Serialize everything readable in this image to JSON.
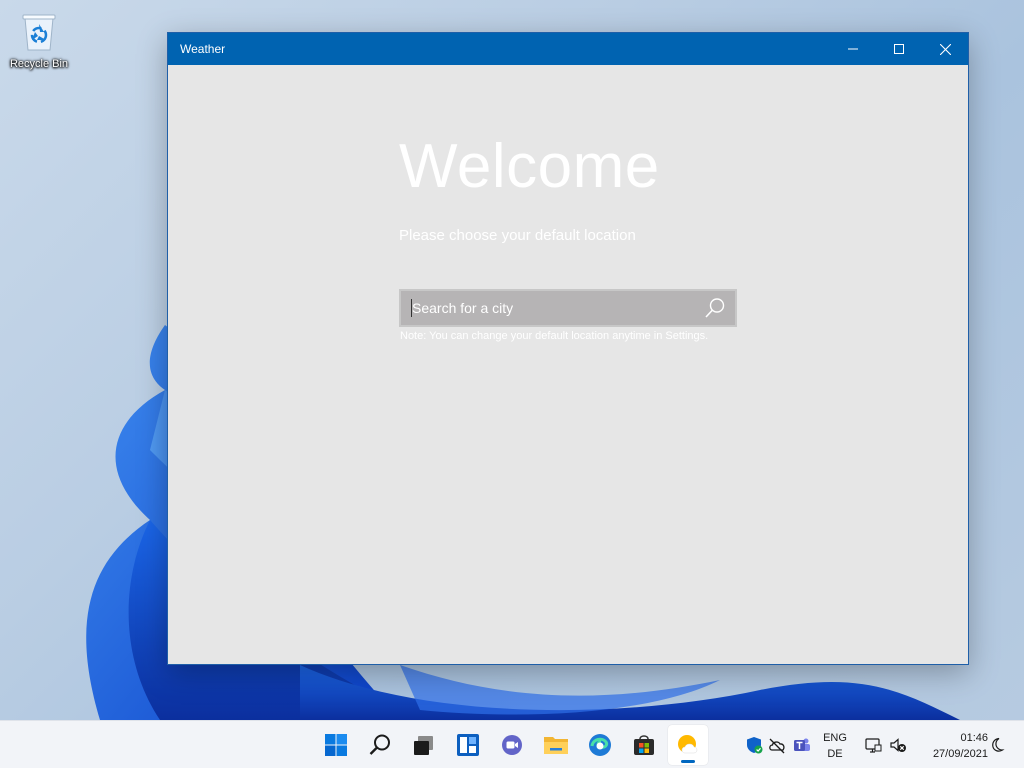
{
  "desktop": {
    "icons": [
      {
        "label": "Recycle Bin",
        "icon": "recycle-bin-icon"
      }
    ]
  },
  "window": {
    "title": "Weather",
    "accent": "#0063b1",
    "content": {
      "heading": "Welcome",
      "subtitle": "Please choose your default location",
      "search": {
        "placeholder": "Search for a city",
        "value": ""
      },
      "note": "Note: You can change your default location anytime in Settings."
    }
  },
  "taskbar": {
    "apps": [
      {
        "name": "start",
        "icon": "windows-start-icon"
      },
      {
        "name": "search",
        "icon": "search-icon"
      },
      {
        "name": "task-view",
        "icon": "task-view-icon"
      },
      {
        "name": "widgets",
        "icon": "widgets-icon"
      },
      {
        "name": "chat",
        "icon": "teams-chat-icon"
      },
      {
        "name": "file-explorer",
        "icon": "folder-icon"
      },
      {
        "name": "edge",
        "icon": "edge-icon"
      },
      {
        "name": "store",
        "icon": "store-icon"
      },
      {
        "name": "weather",
        "icon": "weather-icon",
        "active": true
      }
    ],
    "tray": {
      "icons": [
        "defender-icon",
        "onedrive-offline-icon",
        "teams-icon",
        "network-icon",
        "volume-muted-icon",
        "focus-assist-icon"
      ],
      "language": {
        "line1": "ENG",
        "line2": "DE"
      },
      "time": "01:46",
      "date": "27/09/2021"
    }
  }
}
